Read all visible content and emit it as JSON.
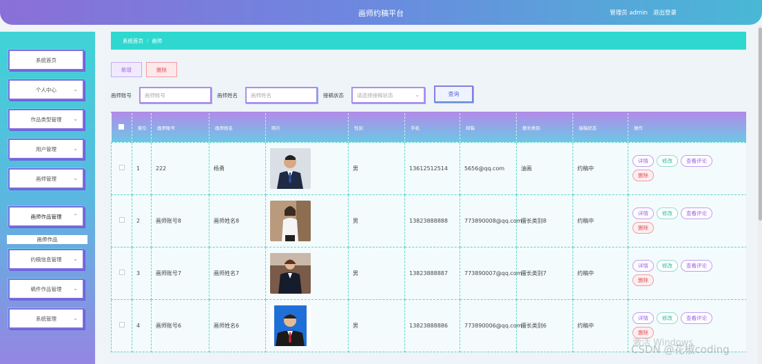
{
  "header": {
    "title": "画师约稿平台",
    "user": "管理员 admin",
    "logout": "退出登录"
  },
  "sidebar": {
    "items": [
      {
        "label": "系统首页",
        "has_chevron": false
      },
      {
        "label": "个人中心",
        "has_chevron": true
      },
      {
        "label": "作品类型管理",
        "has_chevron": true
      },
      {
        "label": "用户管理",
        "has_chevron": true
      },
      {
        "label": "画师管理",
        "has_chevron": true
      },
      {
        "label": "画师作品管理",
        "has_chevron": true,
        "expanded": true
      },
      {
        "label": "约稿信息管理",
        "has_chevron": true
      },
      {
        "label": "稿件作品管理",
        "has_chevron": true
      },
      {
        "label": "系统管理",
        "has_chevron": true
      }
    ],
    "submenu": "画师作品",
    "chevron_down": "⌄",
    "chevron_up": "⌃"
  },
  "breadcrumb": {
    "home": "系统首页",
    "separator": "⁝",
    "current": "画师"
  },
  "toolbar": {
    "add": "新增",
    "delete": "删除"
  },
  "search": {
    "account_label": "画师账号",
    "account_placeholder": "画师账号",
    "name_label": "画师姓名",
    "name_placeholder": "画师姓名",
    "status_label": "接稿状态",
    "status_placeholder": "请选择接稿状态",
    "button": "查询"
  },
  "table": {
    "headers": [
      "索引",
      "画师账号",
      "画师姓名",
      "照片",
      "性别",
      "手机",
      "邮箱",
      "擅长类别",
      "接稿状态",
      "操作"
    ],
    "rows": [
      {
        "index": "1",
        "account": "222",
        "name": "杨勇",
        "gender": "男",
        "phone": "13612512514",
        "email": "5656@qq.com",
        "category": "油画",
        "status": "约稿中",
        "photo": "male-blue-suit"
      },
      {
        "index": "2",
        "account": "画师账号8",
        "name": "画师姓名8",
        "gender": "男",
        "phone": "13823888888",
        "email": "773890008@qq.com",
        "category": "擅长类别8",
        "status": "约稿中",
        "photo": "female-white-blouse"
      },
      {
        "index": "3",
        "account": "画师账号7",
        "name": "画师姓名7",
        "gender": "男",
        "phone": "13823888887",
        "email": "773890007@qq.com",
        "category": "擅长类别7",
        "status": "约稿中",
        "photo": "male-dark-suit"
      },
      {
        "index": "4",
        "account": "画师账号6",
        "name": "画师姓名6",
        "gender": "男",
        "phone": "13823888886",
        "email": "773890006@qq.com",
        "category": "擅长类别6",
        "status": "约稿中",
        "photo": "male-id-photo"
      }
    ],
    "actions": {
      "detail": "详情",
      "edit": "修改",
      "review": "查看评论",
      "delete": "删除"
    }
  },
  "overlay": {
    "windows": "激活 Windows",
    "watermark": "CSDN @花椒coding"
  }
}
